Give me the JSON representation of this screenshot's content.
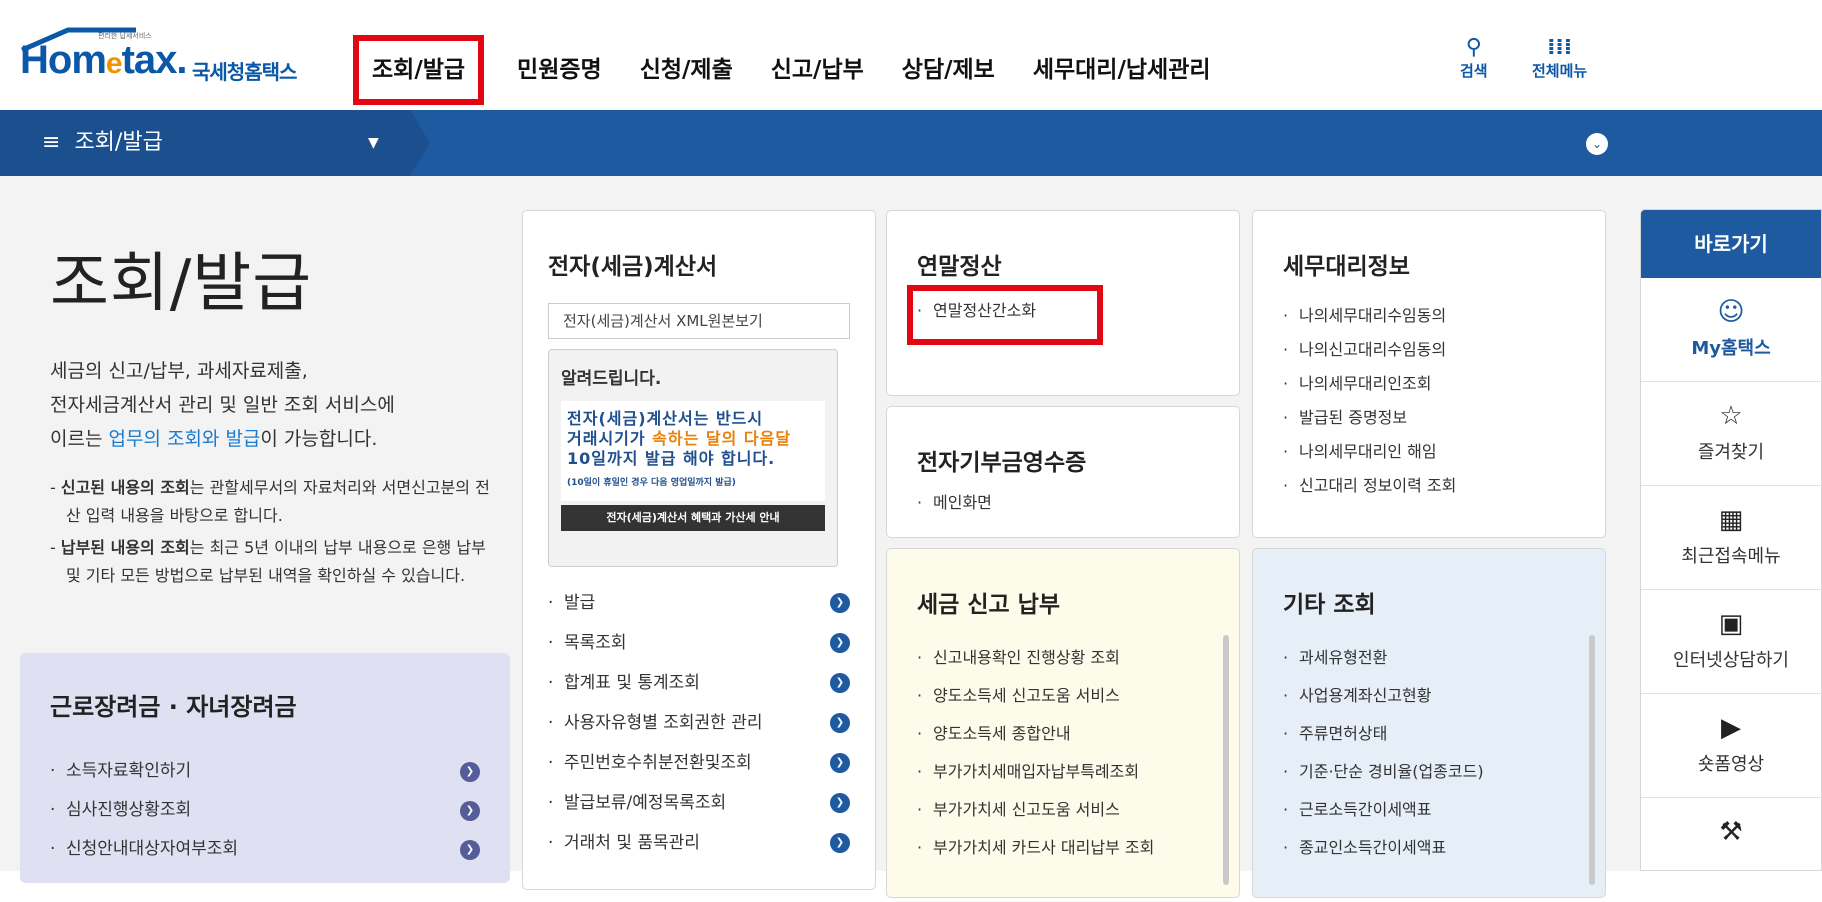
{
  "header": {
    "logo_small": "편리한 납세서비스",
    "logo_en_1": "Hom",
    "logo_en_e": "e",
    "logo_en_2": "tax.",
    "logo_kr": "국세청홈택스",
    "nav": [
      "조회/발급",
      "민원증명",
      "신청/제출",
      "신고/납부",
      "상담/제보",
      "세무대리/납세관리"
    ],
    "search_label": "검색",
    "allmenu_label": "전체메뉴"
  },
  "bar": {
    "current_menu": "조회/발급"
  },
  "intro": {
    "title": "조회/발급",
    "desc_1": "세금의 신고/납부, 과세자료제출,",
    "desc_2": "전자세금계산서 관리 및 일반 조회 서비스에",
    "desc_3_pre": "이르는 ",
    "desc_3_hl": "업무의 조회와 발급",
    "desc_3_post": "이 가능합니다.",
    "note1_b": "신고된 내용의 조회",
    "note1": "는 관할세무서의 자료처리와 서면신고분의 전산 입력 내용을 바탕으로 합니다.",
    "note2_b": "납부된 내용의 조회",
    "note2": "는 최근 5년 이내의 납부 내용으로 은행 납부 및 기타 모든 방법으로 납부된 내역을 확인하실 수 있습니다."
  },
  "reward": {
    "title": "근로장려금 · 자녀장려금",
    "items": [
      "소득자료확인하기",
      "심사진행상황조회",
      "신청안내대상자여부조회"
    ]
  },
  "einvoice": {
    "title": "전자(세금)계산서",
    "xml_button": "전자(세금)계산서 XML원본보기",
    "notice_title": "알려드립니다.",
    "notice_1": "전자(세금)계산서는 반드시",
    "notice_2_pre": "거래시기가 ",
    "notice_2_hl": "속하는 달의 다음달",
    "notice_3": "10일까지 발급 해야 합니다.",
    "notice_small": "(10일이 휴일인 경우 다음 영업일까지 발급)",
    "notice_button": "전자(세금)계산서 혜택과 가산세 안내",
    "items": [
      "발급",
      "목록조회",
      "합계표 및 통계조회",
      "사용자유형별 조회권한 관리",
      "주민번호수취분전환및조회",
      "발급보류/예정목록조회",
      "거래처 및 품목관리"
    ]
  },
  "yearend": {
    "title": "연말정산",
    "items": [
      "연말정산간소화"
    ]
  },
  "donation": {
    "title": "전자기부금영수증",
    "items": [
      "메인화면"
    ]
  },
  "agent": {
    "title": "세무대리정보",
    "items": [
      "나의세무대리수임동의",
      "나의신고대리수임동의",
      "나의세무대리인조회",
      "발급된 증명정보",
      "나의세무대리인 해임",
      "신고대리 정보이력 조회"
    ]
  },
  "taxreport": {
    "title": "세금 신고 납부",
    "items": [
      "신고내용확인 진행상황 조회",
      "양도소득세 신고도움 서비스",
      "양도소득세 종합안내",
      "부가가치세매입자납부특례조회",
      "부가가치세 신고도움 서비스",
      "부가가치세 카드사 대리납부 조회"
    ]
  },
  "etc": {
    "title": "기타 조회",
    "items": [
      "과세유형전환",
      "사업용계좌신고현황",
      "주류면허상태",
      "기준·단순 경비율(업종코드)",
      "근로소득간이세액표",
      "종교인소득간이세액표"
    ]
  },
  "quick": {
    "title": "바로가기",
    "items": [
      "My홈택스",
      "즐겨찾기",
      "최근접속메뉴",
      "인터넷상담하기",
      "숏폼영상"
    ]
  },
  "colors": {
    "primary": "#1d5aa0",
    "highlight_border": "#e30613",
    "logo_orange": "#f29200"
  }
}
